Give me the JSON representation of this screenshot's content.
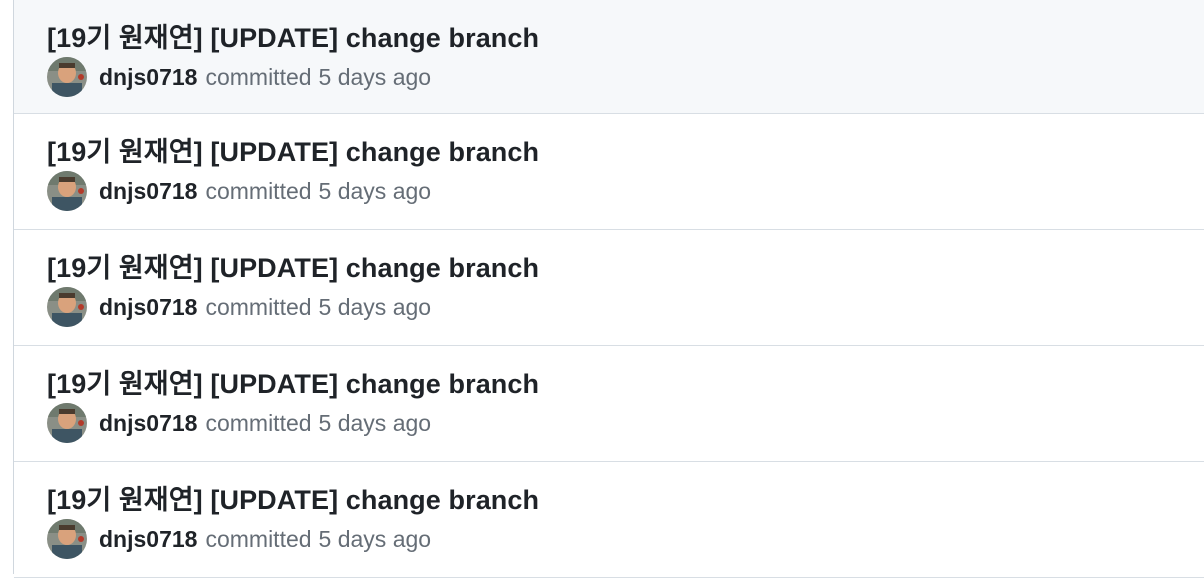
{
  "commits": [
    {
      "title": "[19기 원재연] [UPDATE] change branch",
      "author": "dnjs0718",
      "action": "committed",
      "time": "5 days ago",
      "avatar_icon": "user-avatar"
    },
    {
      "title": "[19기 원재연] [UPDATE] change branch",
      "author": "dnjs0718",
      "action": "committed",
      "time": "5 days ago",
      "avatar_icon": "user-avatar"
    },
    {
      "title": "[19기 원재연] [UPDATE] change branch",
      "author": "dnjs0718",
      "action": "committed",
      "time": "5 days ago",
      "avatar_icon": "user-avatar"
    },
    {
      "title": "[19기 원재연] [UPDATE] change branch",
      "author": "dnjs0718",
      "action": "committed",
      "time": "5 days ago",
      "avatar_icon": "user-avatar"
    },
    {
      "title": "[19기 원재연] [UPDATE] change branch",
      "author": "dnjs0718",
      "action": "committed",
      "time": "5 days ago",
      "avatar_icon": "user-avatar"
    }
  ],
  "colors": {
    "row_hover": "#f6f8fa",
    "border": "#d8dee4",
    "text_primary": "#1f2328",
    "text_muted": "#656d76"
  }
}
